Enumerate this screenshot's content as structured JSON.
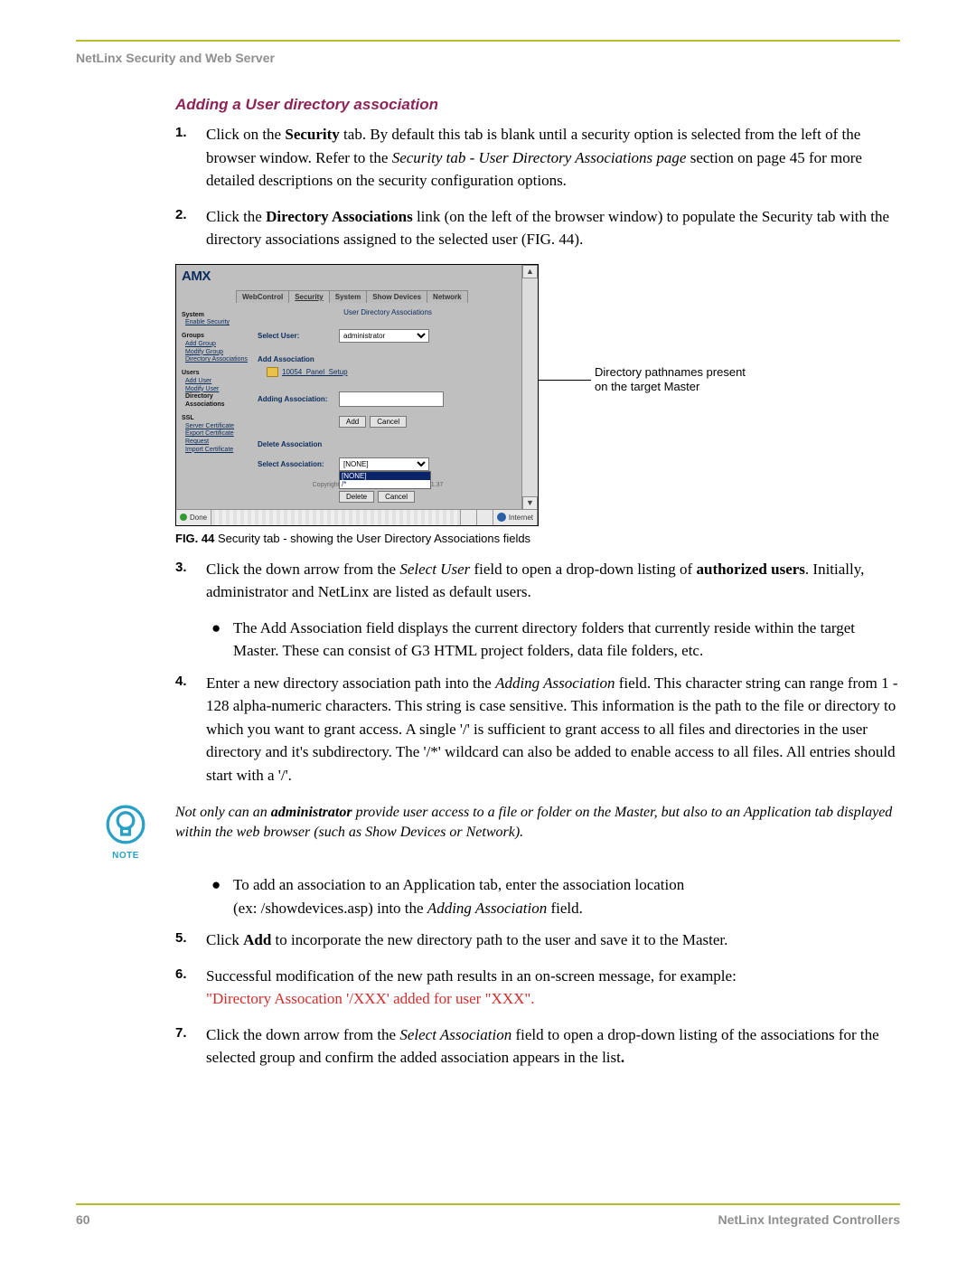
{
  "header": {
    "running": "NetLinx Security and Web Server"
  },
  "section": {
    "title": "Adding a User directory association"
  },
  "steps": {
    "s1": {
      "num": "1.",
      "pre": "Click on the ",
      "bold1": "Security",
      "mid1": " tab. By default this tab is blank until a security option is selected from the left of the browser window. Refer to the ",
      "ital1": "Security tab - User Directory Associations page",
      "mid2": " section on page 45 for more detailed descriptions on the security configuration options."
    },
    "s2": {
      "num": "2.",
      "pre": "Click the ",
      "bold1": "Directory Associations",
      "post": " link (on the left of the browser window) to populate the Security tab with the directory associations assigned to the selected user (FIG. 44)."
    },
    "s3": {
      "num": "3.",
      "pre": "Click the down arrow from the ",
      "ital1": "Select User",
      "mid1": " field to open a drop-down listing of ",
      "bold1": "authorized users",
      "post": ". Initially, administrator and NetLinx are listed as default users."
    },
    "s3b": {
      "text": "The Add Association field displays the current directory folders that currently reside within the target Master. These can consist of G3 HTML project folders, data file folders, etc."
    },
    "s4": {
      "num": "4.",
      "pre": "Enter a new directory association path into the ",
      "ital1": "Adding Association",
      "post": " field. This character string can range from 1 - 128 alpha-numeric characters. This string is case sensitive. This information is the path to the file or directory to which you want to grant access. A single '/' is sufficient to grant access to all files and directories in the user directory and it's subdirectory. The '/*' wildcard can also be added to enable access to all files. All entries should start with a '/'."
    },
    "s5b1": {
      "l1": "To add an association to an Application tab, enter the association location",
      "l2a": "(ex: /showdevices.asp) into the ",
      "l2i": "Adding Association",
      "l2b": " field."
    },
    "s5": {
      "num": "5.",
      "pre": "Click ",
      "bold1": "Add",
      "post": " to incorporate the new directory path to the user and save it to the Master."
    },
    "s6": {
      "num": "6.",
      "l1": "Successful modification of the new path results in an on-screen message, for example:",
      "l2": "\"Directory Assocation '/XXX' added for user \"XXX\"."
    },
    "s7": {
      "num": "7.",
      "pre": "Click the down arrow from the ",
      "ital1": "Select Association",
      "mid1": " field to open a drop-down listing of the associations for the selected group and confirm the added association appears in the list",
      "bold_period": "."
    }
  },
  "note": {
    "label": "NOTE",
    "pre": "Not only can an ",
    "bold": "administrator",
    "post": " provide user access to a file or folder on the Master, but also to an Application tab displayed within the web browser (such as Show Devices or Network)."
  },
  "figcap": {
    "lbl": "FIG. 44",
    "txt": "  Security tab - showing the User Directory Associations fields"
  },
  "callout": {
    "l1": "Directory pathnames present",
    "l2": "on the target Master"
  },
  "screenshot": {
    "logo": "AMX",
    "tabs": {
      "t1": "WebControl",
      "t2": "Security",
      "t3": "System",
      "t4": "Show Devices",
      "t5": "Network"
    },
    "sidebar": {
      "h1": "System",
      "i1": "Enable Security",
      "h2": "Groups",
      "i2": "Add Group",
      "i3": "Modify Group",
      "i4": "Directory Associations",
      "h3": "Users",
      "i5": "Add User",
      "i6": "Modify User",
      "i7a": "Directory",
      "i7b": "Associations",
      "h4": "SSL",
      "i8": "Server Certificate",
      "i9": "Export Certificate Request",
      "i10": "Import Certificate"
    },
    "main": {
      "title": "User Directory Associations",
      "select_user_lbl": "Select User:",
      "select_user_val": "administrator",
      "add_hdr": "Add Association",
      "folder": "10054_Panel_Setup",
      "adding_lbl": "Adding Association:",
      "adding_val": "",
      "btn_add": "Add",
      "btn_cancel": "Cancel",
      "del_hdr": "Delete Association",
      "select_assoc_lbl": "Select Association:",
      "select_assoc_val": "[NONE]",
      "dd_opt1": "[NONE]",
      "dd_opt2": "/*",
      "btn_delete": "Delete",
      "copyright": "Copyright AMX Corp.   NetLinx version v2.31.37"
    },
    "statusbar": {
      "done": "Done",
      "internet": "Internet"
    }
  },
  "footer": {
    "page": "60",
    "right": "NetLinx Integrated Controllers"
  }
}
